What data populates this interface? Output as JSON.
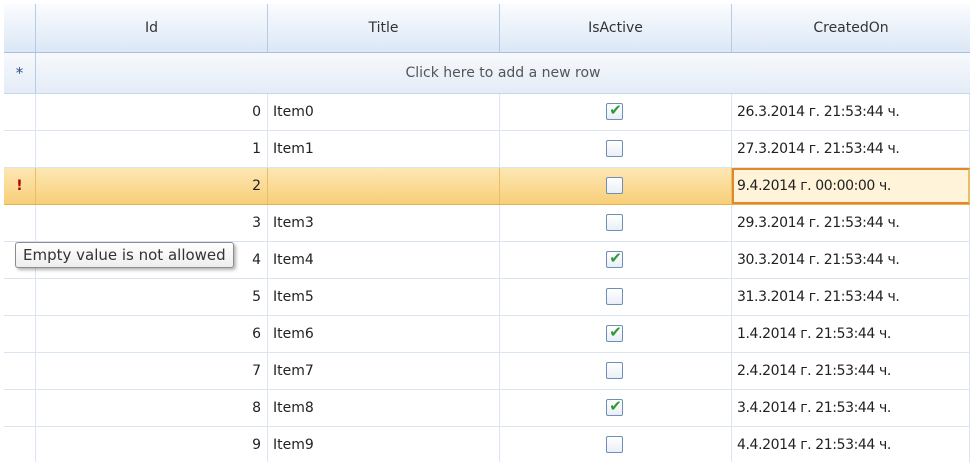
{
  "columns": {
    "id": "Id",
    "title": "Title",
    "isactive": "IsActive",
    "createdon": "CreatedOn"
  },
  "new_row": {
    "indicator": "*",
    "label": "Click here to add a new row"
  },
  "rows": [
    {
      "id": "0",
      "title": "Item0",
      "active": true,
      "created": "26.3.2014 г. 21:53:44 ч."
    },
    {
      "id": "1",
      "title": "Item1",
      "active": false,
      "created": "27.3.2014 г. 21:53:44 ч."
    },
    {
      "id": "2",
      "title": "",
      "active": false,
      "created": "9.4.2014 г. 00:00:00 ч.",
      "indicator": "!",
      "current": true
    },
    {
      "id": "3",
      "title": "Item3",
      "active": false,
      "created": "29.3.2014 г. 21:53:44 ч."
    },
    {
      "id": "4",
      "title": "Item4",
      "active": true,
      "created": "30.3.2014 г. 21:53:44 ч."
    },
    {
      "id": "5",
      "title": "Item5",
      "active": false,
      "created": "31.3.2014 г. 21:53:44 ч."
    },
    {
      "id": "6",
      "title": "Item6",
      "active": true,
      "created": "1.4.2014 г. 21:53:44 ч."
    },
    {
      "id": "7",
      "title": "Item7",
      "active": false,
      "created": "2.4.2014 г. 21:53:44 ч."
    },
    {
      "id": "8",
      "title": "Item8",
      "active": true,
      "created": "3.4.2014 г. 21:53:44 ч."
    },
    {
      "id": "9",
      "title": "Item9",
      "active": false,
      "created": "4.4.2014 г. 21:53:44 ч."
    }
  ],
  "validation_tooltip": "Empty value is not allowed",
  "colors": {
    "current_row": "#f8cf78",
    "editing_border": "#e4862a",
    "header": "#dbe7f6",
    "check": "#2e9a35"
  }
}
